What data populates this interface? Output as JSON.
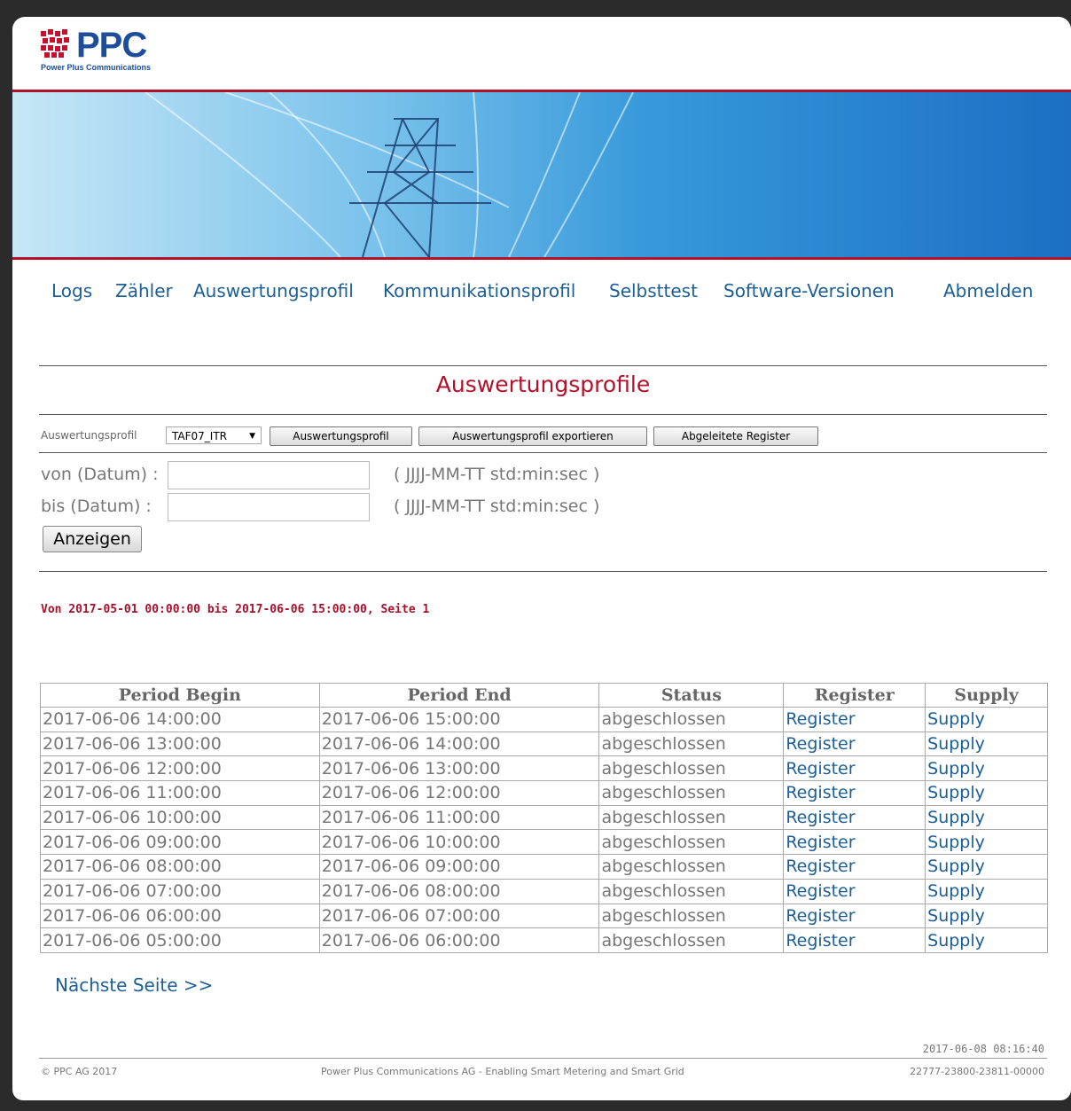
{
  "brand": {
    "logo_text": "PPC",
    "logo_subtitle": "Power Plus Communications",
    "accent_color": "#b3122a",
    "link_color": "#1c5e96"
  },
  "nav": {
    "items": [
      "Logs",
      "Zähler",
      "Auswertungsprofil",
      "Kommunikationsprofil",
      "Selbsttest",
      "Software-Versionen"
    ],
    "logout": "Abmelden"
  },
  "page": {
    "title": "Auswertungsprofile"
  },
  "toolbar": {
    "profile_label": "Auswertungsprofil",
    "profile_selected": "TAF07_ITR",
    "btn_profile": "Auswertungsprofil",
    "btn_export": "Auswertungsprofil exportieren",
    "btn_derived": "Abgeleitete Register"
  },
  "filter": {
    "from_label": "von (Datum) :",
    "to_label": "bis (Datum) :",
    "from_value": "",
    "to_value": "",
    "format_hint": "( JJJJ-MM-TT std:min:sec )",
    "show_button": "Anzeigen"
  },
  "range_info": "Von 2017-05-01 00:00:00 bis 2017-06-06 15:00:00, Seite 1",
  "table": {
    "headers": [
      "Period Begin",
      "Period End",
      "Status",
      "Register",
      "Supply"
    ],
    "rows": [
      {
        "begin": "2017-06-06 14:00:00",
        "end": "2017-06-06 15:00:00",
        "status": "abgeschlossen",
        "register": "Register",
        "supply": "Supply"
      },
      {
        "begin": "2017-06-06 13:00:00",
        "end": "2017-06-06 14:00:00",
        "status": "abgeschlossen",
        "register": "Register",
        "supply": "Supply"
      },
      {
        "begin": "2017-06-06 12:00:00",
        "end": "2017-06-06 13:00:00",
        "status": "abgeschlossen",
        "register": "Register",
        "supply": "Supply"
      },
      {
        "begin": "2017-06-06 11:00:00",
        "end": "2017-06-06 12:00:00",
        "status": "abgeschlossen",
        "register": "Register",
        "supply": "Supply"
      },
      {
        "begin": "2017-06-06 10:00:00",
        "end": "2017-06-06 11:00:00",
        "status": "abgeschlossen",
        "register": "Register",
        "supply": "Supply"
      },
      {
        "begin": "2017-06-06 09:00:00",
        "end": "2017-06-06 10:00:00",
        "status": "abgeschlossen",
        "register": "Register",
        "supply": "Supply"
      },
      {
        "begin": "2017-06-06 08:00:00",
        "end": "2017-06-06 09:00:00",
        "status": "abgeschlossen",
        "register": "Register",
        "supply": "Supply"
      },
      {
        "begin": "2017-06-06 07:00:00",
        "end": "2017-06-06 08:00:00",
        "status": "abgeschlossen",
        "register": "Register",
        "supply": "Supply"
      },
      {
        "begin": "2017-06-06 06:00:00",
        "end": "2017-06-06 07:00:00",
        "status": "abgeschlossen",
        "register": "Register",
        "supply": "Supply"
      },
      {
        "begin": "2017-06-06 05:00:00",
        "end": "2017-06-06 06:00:00",
        "status": "abgeschlossen",
        "register": "Register",
        "supply": "Supply"
      }
    ]
  },
  "pagination": {
    "next": "Nächste Seite >>"
  },
  "footer": {
    "timestamp": "2017-06-08 08:16:40",
    "copyright": "© PPC AG 2017",
    "tagline": "Power Plus Communications AG - Enabling Smart Metering and Smart Grid",
    "device_id": "22777-23800-23811-00000"
  }
}
